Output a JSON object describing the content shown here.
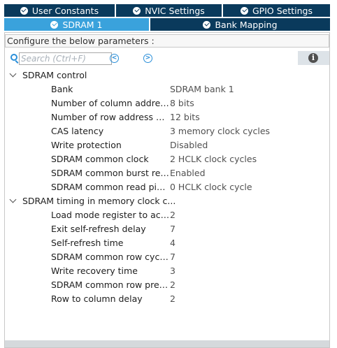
{
  "tabs": {
    "row1": [
      {
        "label": "User Constants",
        "icon": "check-circle-icon"
      },
      {
        "label": "NVIC Settings",
        "icon": "check-circle-icon"
      },
      {
        "label": "GPIO Settings",
        "icon": "check-circle-icon"
      }
    ],
    "row2": [
      {
        "label": "SDRAM 1",
        "icon": "check-circle-icon",
        "active": true
      },
      {
        "label": "Bank Mapping",
        "icon": "check-circle-icon"
      }
    ]
  },
  "panel": {
    "configure_label": "Configure the below parameters :"
  },
  "search": {
    "placeholder": "Search (Ctrl+F)",
    "prev_icon": "chevron-left-circle-icon",
    "next_icon": "chevron-right-circle-icon",
    "prev_glyph": "<",
    "next_glyph": ">",
    "info_icon": "info-icon",
    "info_glyph": "i"
  },
  "groups": [
    {
      "label": "SDRAM control",
      "params": [
        {
          "name": "Bank",
          "value": "SDRAM bank 1"
        },
        {
          "name": "Number of column address...",
          "value": "8 bits"
        },
        {
          "name": "Number of row address bits",
          "value": "12 bits"
        },
        {
          "name": "CAS latency",
          "value": "3 memory clock cycles"
        },
        {
          "name": "Write protection",
          "value": "Disabled"
        },
        {
          "name": "SDRAM common clock",
          "value": "2 HCLK clock cycles"
        },
        {
          "name": "SDRAM common burst read",
          "value": "Enabled"
        },
        {
          "name": "SDRAM common read pip...",
          "value": "0 HCLK clock cycle"
        }
      ]
    },
    {
      "label": "SDRAM timing in memory clock c...",
      "params": [
        {
          "name": "Load mode register to acti...",
          "value": "2"
        },
        {
          "name": "Exit self-refresh delay",
          "value": "7"
        },
        {
          "name": "Self-refresh time",
          "value": "4"
        },
        {
          "name": "SDRAM common row cycl...",
          "value": "7"
        },
        {
          "name": "Write recovery time",
          "value": "3"
        },
        {
          "name": "SDRAM common row prec...",
          "value": "2"
        },
        {
          "name": "Row to column delay",
          "value": "2"
        }
      ]
    }
  ],
  "colors": {
    "tab_bg": "#0a3a5c",
    "tab_active_bg": "#3aa2dc",
    "accent": "#2b8fd9"
  }
}
